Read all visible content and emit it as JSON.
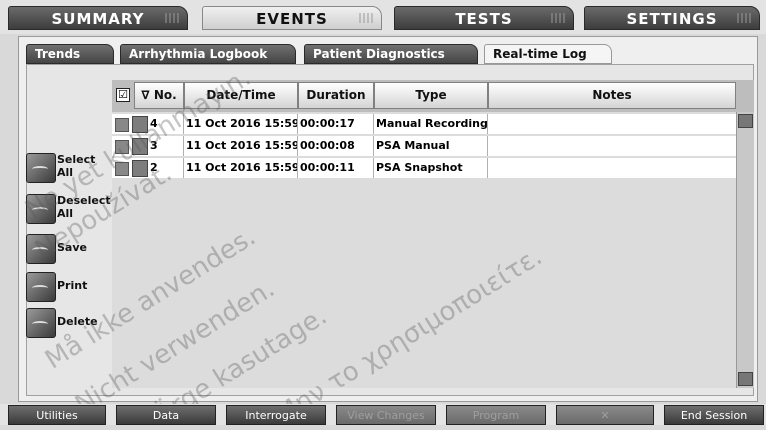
{
  "main_tabs": [
    {
      "label": "SUMMARY"
    },
    {
      "label": "EVENTS"
    },
    {
      "label": "TESTS"
    },
    {
      "label": "SETTINGS"
    }
  ],
  "sub_tabs": [
    {
      "label": "Trends"
    },
    {
      "label": "Arrhythmia Logbook"
    },
    {
      "label": "Patient Diagnostics"
    },
    {
      "label": "Real-time Log"
    }
  ],
  "side_actions": [
    {
      "label": "Select All"
    },
    {
      "label": "Deselect All"
    },
    {
      "label": "Save"
    },
    {
      "label": "Print"
    },
    {
      "label": "Delete"
    }
  ],
  "table": {
    "select_all_mark": "☑",
    "headers": [
      "∇ No.",
      "Date/Time",
      "Duration",
      "Type",
      "Notes"
    ],
    "rows": [
      {
        "no": "4",
        "datetime": "11 Oct 2016 15:59",
        "duration": "00:00:17",
        "type": "Manual Recording",
        "notes": ""
      },
      {
        "no": "3",
        "datetime": "11 Oct 2016 15:59",
        "duration": "00:00:08",
        "type": "PSA Manual",
        "notes": ""
      },
      {
        "no": "2",
        "datetime": "11 Oct 2016 15:59",
        "duration": "00:00:11",
        "type": "PSA Snapshot",
        "notes": ""
      }
    ]
  },
  "bottom_bar": [
    {
      "label": "Utilities"
    },
    {
      "label": "Data"
    },
    {
      "label": "Interrogate"
    },
    {
      "label": "View Changes"
    },
    {
      "label": "Program"
    },
    {
      "label": "✕"
    },
    {
      "label": "End Session"
    }
  ],
  "watermarks": [
    "Ne yet kullanmayın.",
    "Nepoužívat.",
    "Må ikke anvendes.",
    "Nicht verwenden.",
    "Ärge kasutage.",
    "Μην το χρησιμοποιείτε."
  ]
}
